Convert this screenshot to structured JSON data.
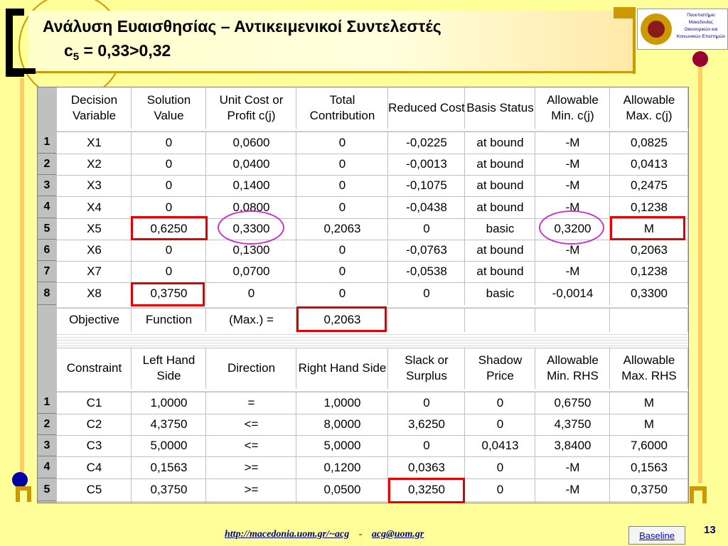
{
  "title": {
    "line1": "Ανάλυση Ευαισθησίας – Αντικειμενικοί Συντελεστές",
    "line2_prefix": "c",
    "line2_sub": "5",
    "line2_rest": " = 0,33>0,32"
  },
  "logo": {
    "line1": "Πανεπιστήμιο",
    "line2": "Μακεδονίας",
    "line3": "Οικονομικών και",
    "line4": "Κοινωνικών Επιστημών"
  },
  "decision_table": {
    "headers": [
      "Decision Variable",
      "Solution Value",
      "Unit Cost or Profit c(j)",
      "Total Contribution",
      "Reduced Cost",
      "Basis Status",
      "Allowable Min. c(j)",
      "Allowable Max. c(j)"
    ],
    "rows": [
      {
        "n": "1",
        "cells": [
          "X1",
          "0",
          "0,0600",
          "0",
          "-0,0225",
          "at bound",
          "-M",
          "0,0825"
        ]
      },
      {
        "n": "2",
        "cells": [
          "X2",
          "0",
          "0,0400",
          "0",
          "-0,0013",
          "at bound",
          "-M",
          "0,0413"
        ]
      },
      {
        "n": "3",
        "cells": [
          "X3",
          "0",
          "0,1400",
          "0",
          "-0,1075",
          "at bound",
          "-M",
          "0,2475"
        ]
      },
      {
        "n": "4",
        "cells": [
          "X4",
          "0",
          "0,0800",
          "0",
          "-0,0438",
          "at bound",
          "-M",
          "0,1238"
        ]
      },
      {
        "n": "5",
        "cells": [
          "X5",
          "0,6250",
          "0,3300",
          "0,2063",
          "0",
          "basic",
          "0,3200",
          "M"
        ]
      },
      {
        "n": "6",
        "cells": [
          "X6",
          "0",
          "0,1300",
          "0",
          "-0,0763",
          "at bound",
          "-M",
          "0,2063"
        ]
      },
      {
        "n": "7",
        "cells": [
          "X7",
          "0",
          "0,0700",
          "0",
          "-0,0538",
          "at bound",
          "-M",
          "0,1238"
        ]
      },
      {
        "n": "8",
        "cells": [
          "X8",
          "0,3750",
          "0",
          "0",
          "0",
          "basic",
          "-0,0014",
          "0,3300"
        ]
      }
    ],
    "objective": [
      "Objective",
      "Function",
      "(Max.) =",
      "0,2063"
    ]
  },
  "constraint_table": {
    "headers": [
      "Constraint",
      "Left Hand Side",
      "Direction",
      "Right Hand Side",
      "Slack or Surplus",
      "Shadow Price",
      "Allowable Min. RHS",
      "Allowable Max. RHS"
    ],
    "rows": [
      {
        "n": "1",
        "cells": [
          "C1",
          "1,0000",
          "=",
          "1,0000",
          "0",
          "0",
          "0,6750",
          "M"
        ]
      },
      {
        "n": "2",
        "cells": [
          "C2",
          "4,3750",
          "<=",
          "8,0000",
          "3,6250",
          "0",
          "4,3750",
          "M"
        ]
      },
      {
        "n": "3",
        "cells": [
          "C3",
          "5,0000",
          "<=",
          "5,0000",
          "0",
          "0,0413",
          "3,8400",
          "7,6000"
        ]
      },
      {
        "n": "4",
        "cells": [
          "C4",
          "0,1563",
          ">=",
          "0,1200",
          "0,0363",
          "0",
          "-M",
          "0,1563"
        ]
      },
      {
        "n": "5",
        "cells": [
          "C5",
          "0,3750",
          ">=",
          "0,0500",
          "0,3250",
          "0",
          "-M",
          "0,3750"
        ]
      }
    ]
  },
  "footer": {
    "link1": "http://macedonia.uom.gr/~acg",
    "separator": "-",
    "link2": "acg@uom.gr",
    "baseline": "Baseline",
    "page": "13"
  },
  "colors": {
    "background": "#ffff99",
    "accent_gold": "#cc9900",
    "highlight_red": "#e00000",
    "highlight_magenta": "#cc33cc",
    "footer_text": "#000080"
  }
}
